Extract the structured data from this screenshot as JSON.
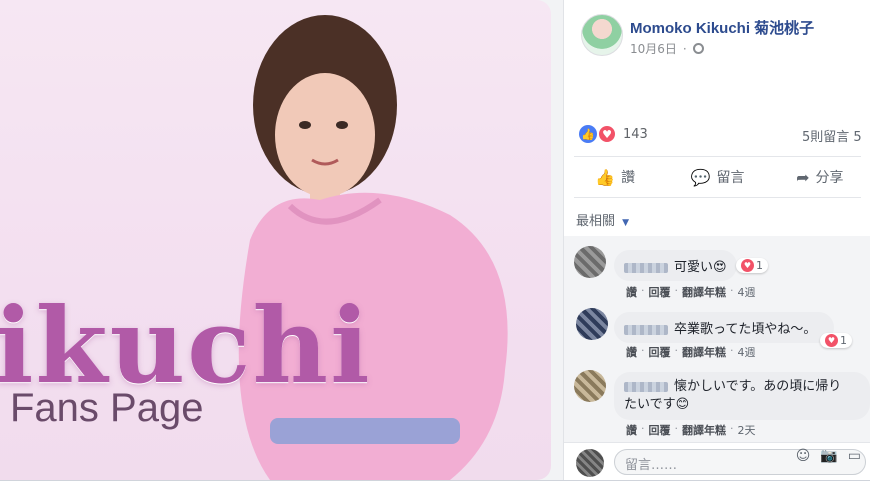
{
  "photo": {
    "title_big": "ikuchi",
    "title_sub": "Fans Page"
  },
  "post": {
    "author": "Momoko Kikuchi 菊池桃子",
    "date": "10月6日",
    "reaction_count": "143",
    "comment_summary": "5則留言 5",
    "actions": [
      "讚",
      "留言",
      "分享"
    ],
    "sort_label": "最相關"
  },
  "comments": [
    {
      "text": "可愛い😍",
      "reaction": "1",
      "actions": [
        "讚",
        "回覆",
        "翻譯年糕"
      ],
      "time": "4週"
    },
    {
      "text": "卒業歌ってた頃やね〜。",
      "reaction": "1",
      "actions": [
        "讚",
        "回覆",
        "翻譯年糕"
      ],
      "time": "4週"
    },
    {
      "text": "懐かしいです。あの頃に帰り",
      "text2": "たいです😊",
      "actions": [
        "讚",
        "回覆",
        "翻譯年糕"
      ],
      "time": "2天"
    }
  ],
  "composer": {
    "placeholder": "留言……"
  },
  "icons": {
    "like": "thumbs-up-icon",
    "comment": "speech-bubble-icon",
    "share": "share-arrow-icon",
    "emoji": "emoji-icon",
    "camera": "camera-icon",
    "gif": "gif-icon"
  },
  "colors": {
    "accent": "#4267b2",
    "love": "#f25268",
    "like": "#4a7cf5"
  }
}
